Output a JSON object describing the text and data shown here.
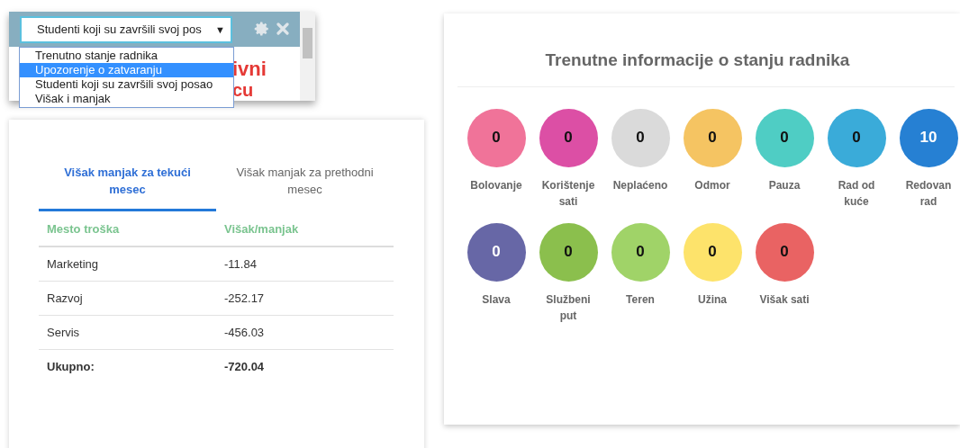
{
  "widget": {
    "select": {
      "value": "Studenti koji su završili svoj pos",
      "arrow": "▼"
    },
    "options": [
      {
        "label": "Trenutno stanje radnika",
        "selected": false
      },
      {
        "label": "Upozorenje o zatvaranju",
        "selected": true
      },
      {
        "label": "Studenti koji su završili svoj posao",
        "selected": false
      },
      {
        "label": "Višak i manjak",
        "selected": false
      }
    ],
    "background_text": [
      "ivni",
      "cu"
    ]
  },
  "surplus_card": {
    "tabs": [
      {
        "label": "Višak manjak za tekući mesec",
        "selected": true
      },
      {
        "label": "Višak manjak za prethodni mesec",
        "selected": false
      }
    ],
    "table": {
      "columns": [
        "Mesto troška",
        "Višak/manjak"
      ],
      "rows": [
        {
          "kind": "normal",
          "cells": [
            "Marketing",
            "-11.84"
          ]
        },
        {
          "kind": "normal",
          "cells": [
            "Razvoj",
            "-252.17"
          ]
        },
        {
          "kind": "normal",
          "cells": [
            "Servis",
            "-456.03"
          ]
        },
        {
          "kind": "total",
          "cells": [
            "Ukupno:",
            "-720.04"
          ]
        }
      ]
    }
  },
  "status_card": {
    "title": "Trenutne informacije o stanju radnika",
    "items": [
      {
        "label": "Bolovanje",
        "value": "0",
        "color": "#f07399"
      },
      {
        "label": "Korištenje sati",
        "value": "0",
        "color": "#dc4fa5"
      },
      {
        "label": "Neplaćeno",
        "value": "0",
        "color": "#dadada"
      },
      {
        "label": "Odmor",
        "value": "0",
        "color": "#f5c462"
      },
      {
        "label": "Pauza",
        "value": "0",
        "color": "#4fcdc4"
      },
      {
        "label": "Rad od kuće",
        "value": "0",
        "color": "#3aabd9"
      },
      {
        "label": "Redovan rad",
        "value": "10",
        "color": "#2680d3"
      },
      {
        "label": "Slava",
        "value": "0",
        "color": "#6767a6"
      },
      {
        "label": "Službeni put",
        "value": "0",
        "color": "#8bbf4d"
      },
      {
        "label": "Teren",
        "value": "0",
        "color": "#a0d368"
      },
      {
        "label": "Užina",
        "value": "0",
        "color": "#fde36b"
      },
      {
        "label": "Višak sati",
        "value": "0",
        "color": "#e96363"
      }
    ]
  }
}
